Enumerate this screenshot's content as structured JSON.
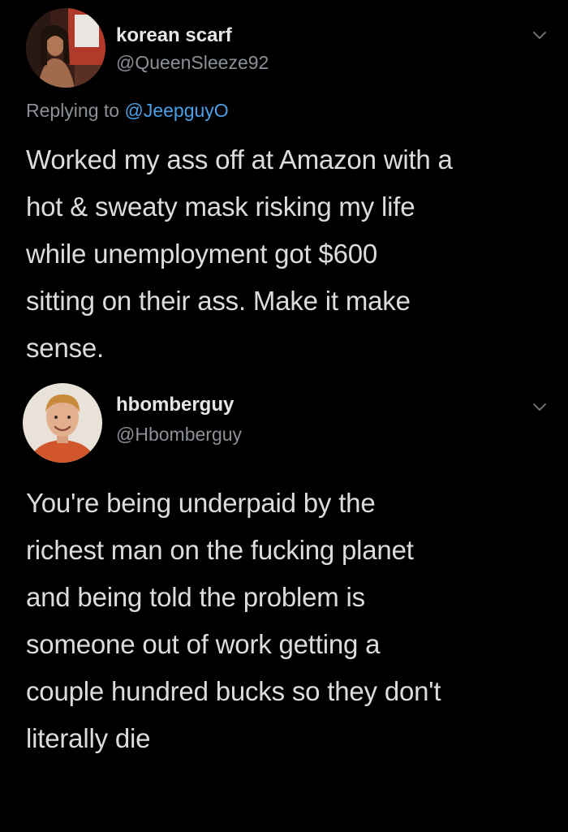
{
  "tweets": [
    {
      "display_name": "korean scarf",
      "handle": "@QueenSleeze92",
      "reply_prefix": "Replying to ",
      "reply_to": "@JeepguyO",
      "body_lines": [
        "Worked my ass off at Amazon with a",
        "hot & sweaty mask risking my life",
        "while unemployment got $600",
        "sitting on their ass. Make it make",
        "sense."
      ],
      "avatar_icon": "profile-photo-icon",
      "menu_icon": "chevron-down-icon"
    },
    {
      "display_name": "hbomberguy",
      "handle": "@Hbomberguy",
      "body_lines": [
        "You're being underpaid by the",
        "richest man on the fucking planet",
        "and being told the problem is",
        "someone out of work getting a",
        "couple hundred bucks so they don't",
        "literally die"
      ],
      "avatar_icon": "profile-photo-icon",
      "menu_icon": "chevron-down-icon"
    }
  ],
  "colors": {
    "background": "#000000",
    "text": "#dcdcdc",
    "secondary": "#8b9097",
    "link": "#4a9fe6"
  }
}
